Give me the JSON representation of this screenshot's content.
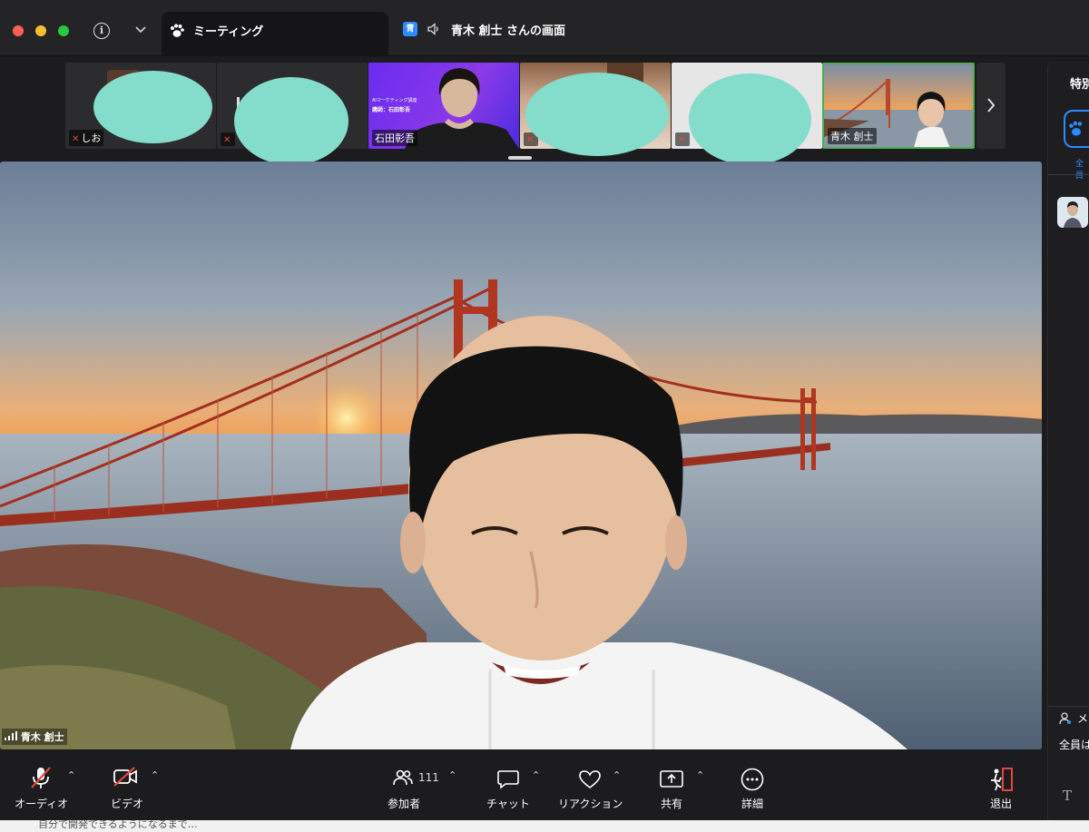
{
  "window": {
    "tab_meeting_label": "ミーティング",
    "share_badge": "青",
    "share_tab_label": "青木 創士 さんの画面"
  },
  "strip": {
    "participants": [
      {
        "name": "しお",
        "muted": true
      },
      {
        "name": "",
        "muted": true
      },
      {
        "name": "石田彰吾",
        "muted": false,
        "slide_title": "AIマーケティング講座",
        "slide_sub": "講師：石田彰吾"
      },
      {
        "name": "",
        "muted": true
      },
      {
        "name": "",
        "muted": true
      },
      {
        "name": "青木 創士",
        "muted": false
      }
    ]
  },
  "main": {
    "speaker_name": "青木 創士"
  },
  "side": {
    "title": "特別",
    "all_label": "全員",
    "message_label": "メ",
    "all_to_label": "全員は",
    "text_icon": "T"
  },
  "toolbar": {
    "audio_label": "オーディオ",
    "video_label": "ビデオ",
    "participants_label": "参加者",
    "participants_count": "111",
    "chat_label": "チャット",
    "reaction_label": "リアクション",
    "share_label": "共有",
    "more_label": "詳細",
    "leave_label": "退出",
    "caret": "⌃"
  },
  "colors": {
    "accent": "#2d8cff",
    "mute_red": "#e0483e",
    "active_border": "#4caf50",
    "redaction": "#84dccb"
  },
  "bottom_peek_text": "自分で開発できるようになるまで…"
}
